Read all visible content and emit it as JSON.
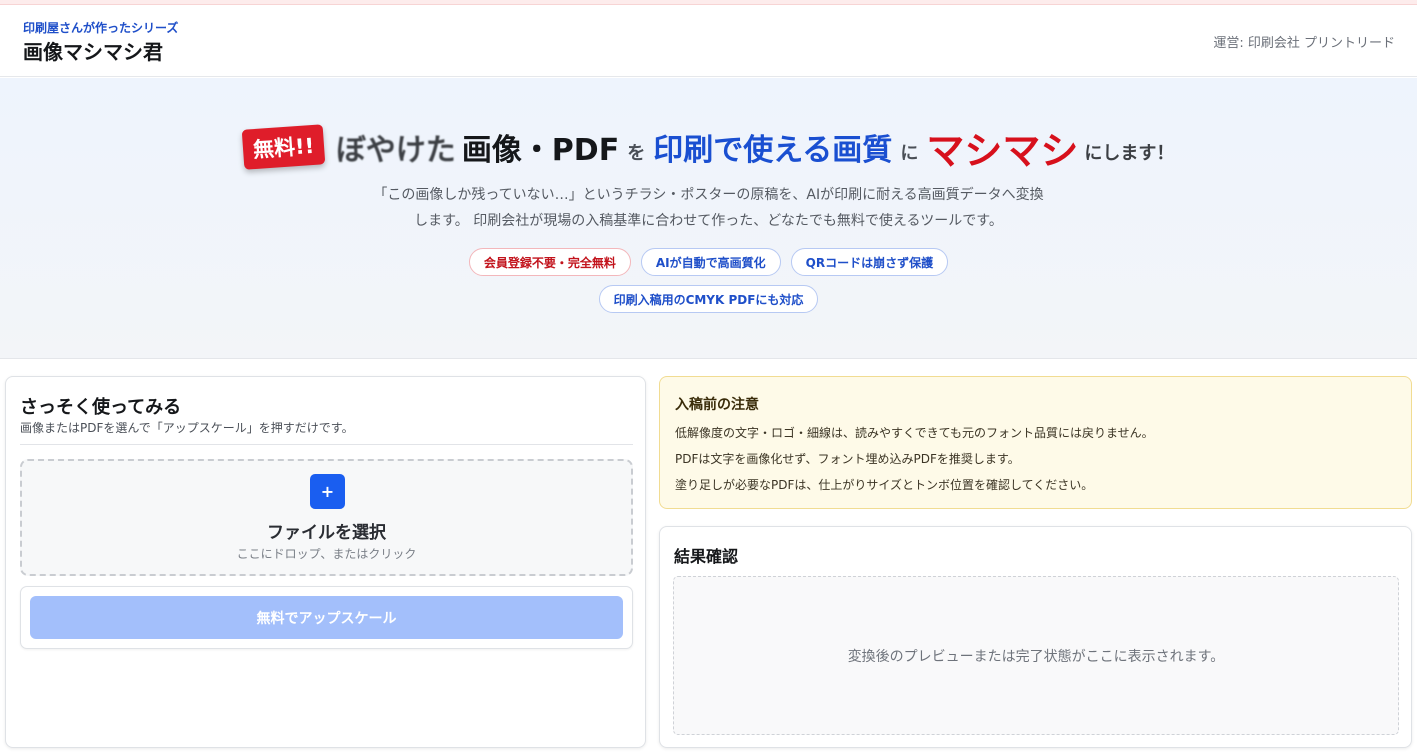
{
  "header": {
    "series": "印刷屋さんが作ったシリーズ",
    "title": "画像マシマシ君",
    "operator": "運営: 印刷会社 プリントリード"
  },
  "hero": {
    "badge": "無料!!",
    "headline": {
      "blurred": "ぼやけた",
      "subject": "画像・PDF",
      "particle1": "を",
      "target": "印刷で使える画質",
      "particle2": "に",
      "emphasis": "マシマシ",
      "tail": "にします！"
    },
    "description_line1": "「この画像しか残っていない…」というチラシ・ポスターの原稿を、AIが印刷に耐える高画質データへ変換",
    "description_line2": "します。 印刷会社が現場の入稿基準に合わせて作った、どなたでも無料で使えるツールです。",
    "pills": [
      "会員登録不要・完全無料",
      "AIが自動で高画質化",
      "QRコードは崩さず保護",
      "印刷入稿用のCMYK PDFにも対応"
    ]
  },
  "upload": {
    "title": "さっそく使ってみる",
    "subtitle": "画像またはPDFを選んで「アップスケール」を押すだけです。",
    "plus_glyph": "+",
    "dropzone_title": "ファイルを選択",
    "dropzone_hint": "ここにドロップ、またはクリック",
    "button_label": "無料でアップスケール"
  },
  "notice": {
    "title": "入稿前の注意",
    "lines": [
      "低解像度の文字・ロゴ・細線は、読みやすくできても元のフォント品質には戻りません。",
      "PDFは文字を画像化せず、フォント埋め込みPDFを推奨します。",
      "塗り足しが必要なPDFは、仕上がりサイズとトンボ位置を確認してください。"
    ]
  },
  "result": {
    "title": "結果確認",
    "placeholder": "変換後のプレビューまたは完了状態がここに表示されます。"
  },
  "colors": {
    "brand_blue": "#1a5ef0",
    "accent_red": "#d7101c",
    "button_disabled": "#a3bffb",
    "notice_bg": "#fefae8"
  }
}
